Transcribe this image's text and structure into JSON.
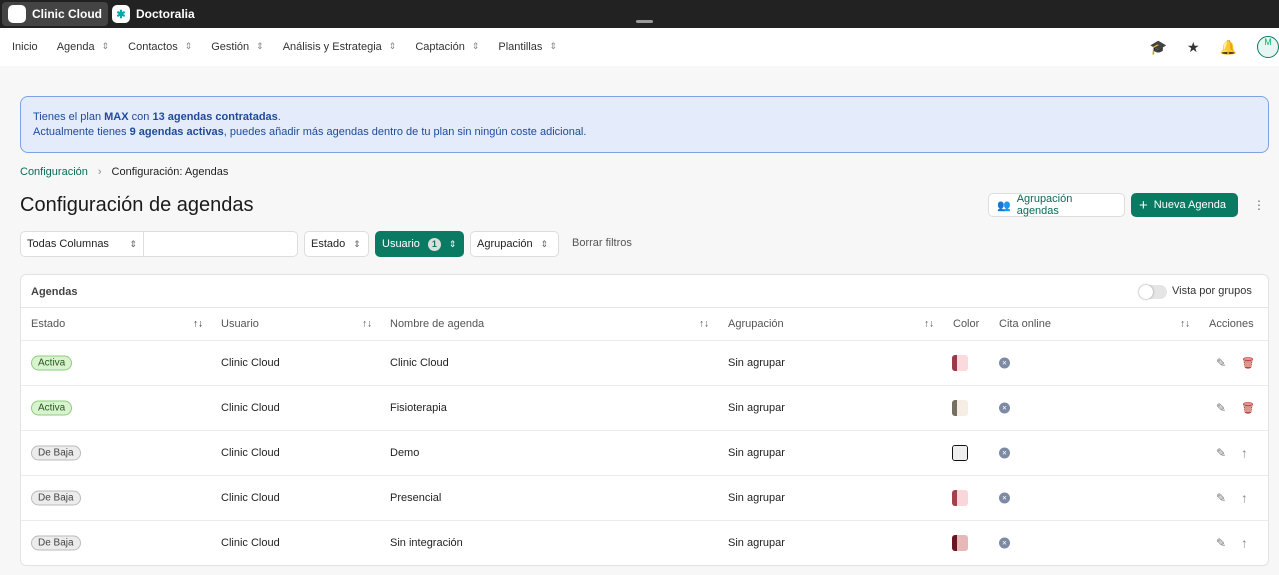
{
  "topbar": {
    "apps": [
      {
        "label": "Clinic Cloud",
        "icon": "cloud-icon"
      },
      {
        "label": "Doctoralia",
        "icon": "doctoralia-icon"
      }
    ]
  },
  "nav": {
    "items": [
      "Inicio",
      "Agenda",
      "Contactos",
      "Gestión",
      "Análisis y Estrategia",
      "Captación",
      "Plantillas"
    ],
    "avatar": "M"
  },
  "banner": {
    "l1a": "Tienes el plan ",
    "plan": "MAX",
    "l1b": " con ",
    "contracted": "13 agendas contratadas",
    "l1c": ".",
    "l2a": "Actualmente tienes ",
    "active": "9 agendas activas",
    "l2b": ", puedes añadir más agendas dentro de tu plan sin ningún coste adicional."
  },
  "breadcrumb": {
    "parent": "Configuración",
    "current": "Configuración: Agendas"
  },
  "title": "Configuración de agendas",
  "actions": {
    "grouping": "Agrupación agendas",
    "new": "Nueva Agenda"
  },
  "filters": {
    "columns": "Todas Columnas",
    "search_value": "",
    "estado": "Estado",
    "usuario": "Usuario",
    "usuario_count": "1",
    "agrupacion": "Agrupación",
    "clear": "Borrar filtros"
  },
  "table": {
    "title": "Agendas",
    "group_toggle": "Vista por grupos",
    "group_toggle_on": false,
    "headers": [
      "Estado",
      "Usuario",
      "Nombre de agenda",
      "Agrupación",
      "Color",
      "Cita online",
      "Acciones"
    ],
    "rows": [
      {
        "estado": "Activa",
        "usuario": "Clinic Cloud",
        "nombre": "Clinic Cloud",
        "agrupacion": "Sin agrupar",
        "color": [
          "#9b3a48",
          "#fbd9dc"
        ],
        "action": "delete"
      },
      {
        "estado": "Activa",
        "usuario": "Clinic Cloud",
        "nombre": "Fisioterapia",
        "agrupacion": "Sin agrupar",
        "color": [
          "#777062",
          "#f6ede4"
        ],
        "action": "delete"
      },
      {
        "estado": "De Baja",
        "usuario": "Clinic Cloud",
        "nombre": "Demo",
        "agrupacion": "Sin agrupar",
        "color": [
          "#eeeeee",
          "#eeeeee"
        ],
        "action": "restore"
      },
      {
        "estado": "De Baja",
        "usuario": "Clinic Cloud",
        "nombre": "Presencial",
        "agrupacion": "Sin agrupar",
        "color": [
          "#a3414d",
          "#f9d6d9"
        ],
        "action": "restore"
      },
      {
        "estado": "De Baja",
        "usuario": "Clinic Cloud",
        "nombre": "Sin integración",
        "agrupacion": "Sin agrupar",
        "color": [
          "#6b1520",
          "#e8b7b7"
        ],
        "action": "restore"
      }
    ]
  }
}
